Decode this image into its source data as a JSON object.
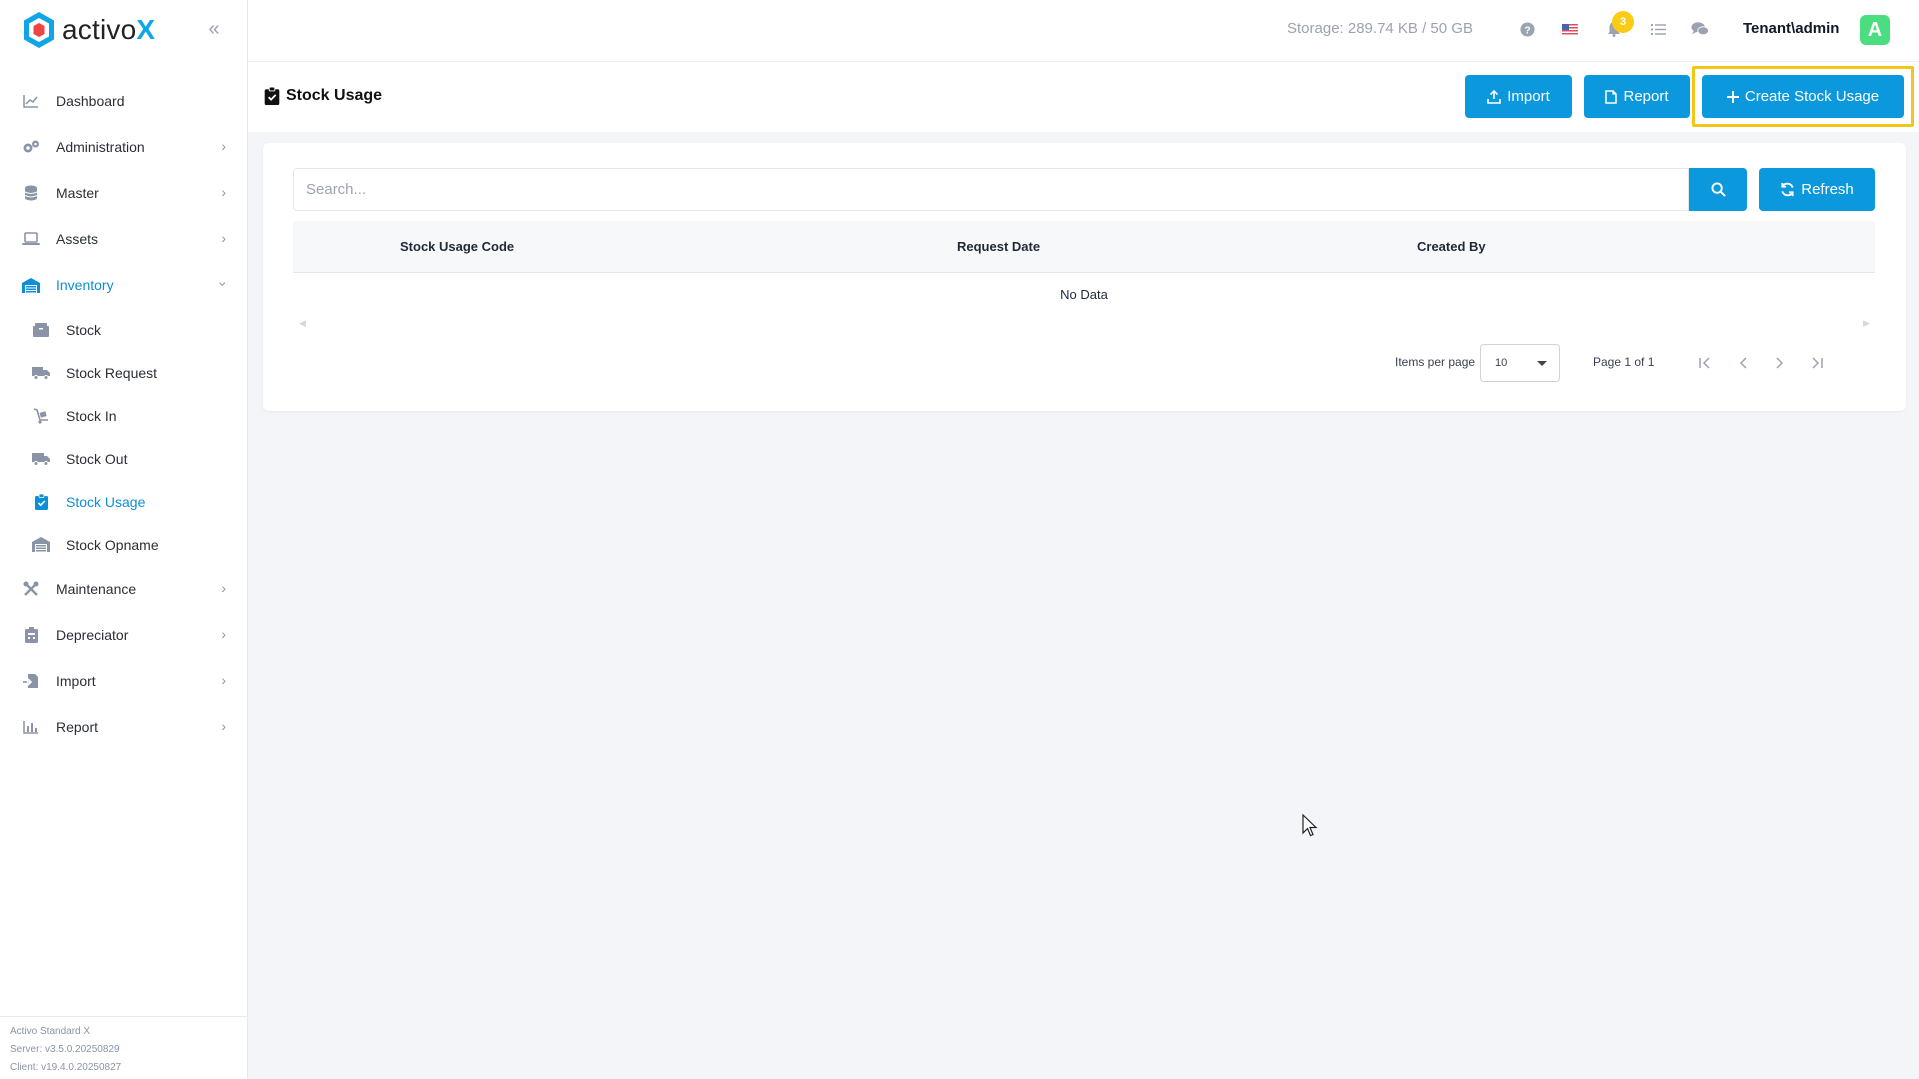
{
  "brand": {
    "name_prefix": "activo",
    "name_suffix": "X"
  },
  "sidebar": {
    "items": [
      {
        "label": "Dashboard"
      },
      {
        "label": "Administration"
      },
      {
        "label": "Master"
      },
      {
        "label": "Assets"
      },
      {
        "label": "Inventory"
      },
      {
        "label": "Maintenance"
      },
      {
        "label": "Depreciator"
      },
      {
        "label": "Import"
      },
      {
        "label": "Report"
      }
    ],
    "inventory_sub": [
      {
        "label": "Stock"
      },
      {
        "label": "Stock Request"
      },
      {
        "label": "Stock In"
      },
      {
        "label": "Stock Out"
      },
      {
        "label": "Stock Usage"
      },
      {
        "label": "Stock Opname"
      }
    ],
    "footer": {
      "product": "Activo Standard X",
      "server": "Server: v3.5.0.20250829",
      "client": "Client: v19.4.0.20250827"
    }
  },
  "topbar": {
    "storage": "Storage: 289.74 KB / 50 GB",
    "notifications_count": "3",
    "user": "Tenant\\admin",
    "avatar_letter": "A"
  },
  "page": {
    "title": "Stock Usage",
    "import_label": "Import",
    "report_label": "Report",
    "create_label": "Create Stock Usage"
  },
  "table": {
    "search_placeholder": "Search...",
    "refresh_label": "Refresh",
    "columns": [
      "Stock Usage Code",
      "Request Date",
      "Created By"
    ],
    "empty_text": "No Data"
  },
  "paginator": {
    "items_per_page_label": "Items per page",
    "page_size": "10",
    "range_label": "Page 1 of 1"
  },
  "colors": {
    "primary": "#0b98dd",
    "active_nav": "#0b8fd6",
    "highlight": "#f5c518",
    "badge": "#facc15",
    "avatar": "#4ade80"
  }
}
